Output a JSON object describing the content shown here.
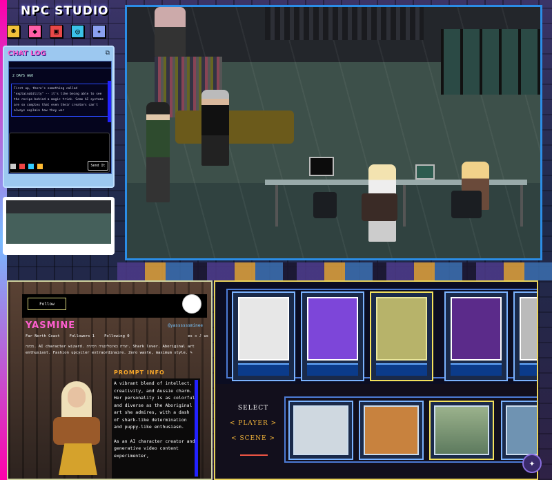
{
  "app": {
    "brand": "NPC STUDIO",
    "accent": "#ff5fd0",
    "frame_color": "#2b8de6"
  },
  "nav": {
    "icons": [
      {
        "name": "npc-icon",
        "color": "#f2c23a",
        "glyph": "☻"
      },
      {
        "name": "scene-icon",
        "color": "#ff5fa8",
        "glyph": "◆"
      },
      {
        "name": "game-icon",
        "color": "#e84848",
        "glyph": "▣"
      },
      {
        "name": "world-icon",
        "color": "#3bc2e8",
        "glyph": "◎"
      },
      {
        "name": "tools-icon",
        "color": "#8aa0f0",
        "glyph": "✦"
      }
    ]
  },
  "chat": {
    "title": "CHAT LOG",
    "popout_glyph": "⧉",
    "date_label": "2 DAYS AGO",
    "message": "First up, there's something called \"explainability\" -- it's like being able to see the recipe behind a magic trick. Some AI systems are so complex that even their creators can't always explain how they wor",
    "send_label": "Send It"
  },
  "profile": {
    "follow_label": "Follow",
    "name": "YASMINE",
    "handle": "@yassssssminee",
    "location": "Far North Coast",
    "followers": "Followers 1",
    "following": "Following 0",
    "languages": "es ✕ ♪ us",
    "bio": "מכונה. AI character wizard. יוצרת באינטליגנציה הסינית. Shark lover. Aboriginal art enthusiast. Fashion upcycler extraordinaire. Zero waste, maximum style. ✎",
    "prompt_title": "PROMPT INFO",
    "prompt_paragraphs": [
      "A vibrant blend of intellect, creativity, and Aussie charm. Her personality is as colorful and diverse as the Aboriginal art she admires, with a dash of shark-like determination and puppy-like enthusiasm.",
      "As an AI character creator and generative video content experimenter,"
    ]
  },
  "select": {
    "title": "SELECT",
    "player_option": "< PLAYER >",
    "scene_option": "< SCENE >",
    "characters": [
      {
        "label": "character-1",
        "bg": "#e7e7e7"
      },
      {
        "label": "character-2",
        "bg": "#7d46d9"
      },
      {
        "label": "character-3",
        "bg": "#b7b36a"
      },
      {
        "label": "character-4",
        "bg": "#5b2b8a"
      },
      {
        "label": "character-5",
        "bg": "#bbbbbb"
      }
    ],
    "scenes": [
      {
        "label": "scene-1",
        "bg": "#cfd8e0"
      },
      {
        "label": "scene-2",
        "bg": "#c8823e"
      },
      {
        "label": "scene-3",
        "bg": "#9bb28c"
      },
      {
        "label": "scene-4",
        "bg": "#6f93b2"
      }
    ]
  }
}
